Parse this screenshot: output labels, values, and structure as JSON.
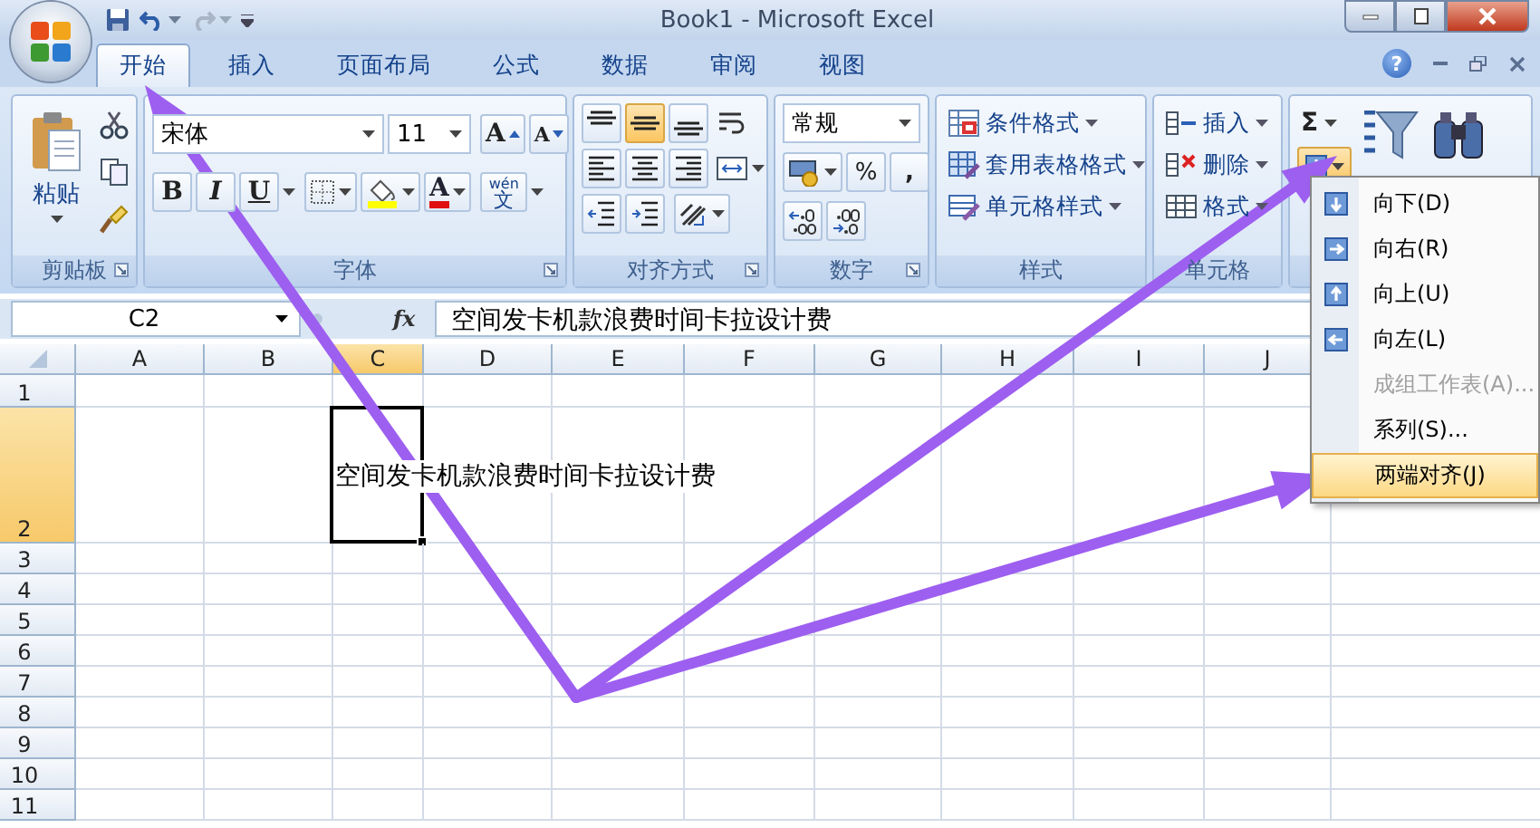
{
  "title_bar": {
    "title": "Book1 - Microsoft Excel"
  },
  "tabs": [
    {
      "label": "开始",
      "selected": true
    },
    {
      "label": "插入",
      "selected": false
    },
    {
      "label": "页面布局",
      "selected": false
    },
    {
      "label": "公式",
      "selected": false
    },
    {
      "label": "数据",
      "selected": false
    },
    {
      "label": "审阅",
      "selected": false
    },
    {
      "label": "视图",
      "selected": false
    }
  ],
  "help": "?",
  "ribbon": {
    "clipboard": {
      "label": "剪贴板",
      "paste": "粘贴"
    },
    "font": {
      "label": "字体",
      "font_name": "宋体",
      "font_size": "11",
      "grow": "A",
      "shrink": "A",
      "bold": "B",
      "italic": "I",
      "underline": "U",
      "font_color": "A",
      "phonetic_hint": "wén",
      "phonetic": "文"
    },
    "alignment": {
      "label": "对齐方式",
      "vertical": [
        {
          "kind": "top",
          "selected": false
        },
        {
          "kind": "middle",
          "selected": true
        },
        {
          "kind": "bottom",
          "selected": false
        }
      ],
      "horizontal": [
        {
          "kind": "left",
          "selected": false
        },
        {
          "kind": "center",
          "selected": false
        },
        {
          "kind": "right",
          "selected": false
        }
      ]
    },
    "number": {
      "label": "数字",
      "format": "常规",
      "percent": "%",
      "comma": ","
    },
    "styles": {
      "label": "样式",
      "items": [
        {
          "kind": "conditional",
          "label": "条件格式"
        },
        {
          "kind": "table",
          "label": "套用表格格式"
        },
        {
          "kind": "cell",
          "label": "单元格样式"
        }
      ]
    },
    "cells": {
      "label": "单元格",
      "items": [
        {
          "kind": "insert",
          "label": "插入"
        },
        {
          "kind": "delete",
          "label": "删除"
        },
        {
          "kind": "format",
          "label": "格式"
        }
      ]
    },
    "editing": {
      "sum": "Σ",
      "fill_expanded": true
    }
  },
  "formula_bar": {
    "name_box": "C2",
    "fx": "fx",
    "content": "空间发卡机款浪费时间卡拉设计费"
  },
  "sheet": {
    "columns": [
      {
        "label": "A",
        "selected": false
      },
      {
        "label": "B",
        "selected": false
      },
      {
        "label": "C",
        "selected": true
      },
      {
        "label": "D",
        "selected": false
      },
      {
        "label": "E",
        "selected": false
      },
      {
        "label": "F",
        "selected": false
      },
      {
        "label": "G",
        "selected": false
      },
      {
        "label": "H",
        "selected": false
      },
      {
        "label": "I",
        "selected": false
      },
      {
        "label": "J",
        "selected": false
      }
    ],
    "rows": [
      {
        "label": "1",
        "selected": false
      },
      {
        "label": "2",
        "selected": true,
        "text": "空间发卡机款浪费时间卡拉设计费"
      },
      {
        "label": "3",
        "selected": false
      },
      {
        "label": "4",
        "selected": false
      },
      {
        "label": "5",
        "selected": false
      },
      {
        "label": "6",
        "selected": false
      },
      {
        "label": "7",
        "selected": false
      },
      {
        "label": "8",
        "selected": false
      },
      {
        "label": "9",
        "selected": false
      },
      {
        "label": "10",
        "selected": false
      },
      {
        "label": "11",
        "selected": false
      }
    ]
  },
  "fill_menu": {
    "items": [
      {
        "kind": "down",
        "label": "向下(D)",
        "disabled": false,
        "selected": false
      },
      {
        "kind": "right",
        "label": "向右(R)",
        "disabled": false,
        "selected": false
      },
      {
        "kind": "up",
        "label": "向上(U)",
        "disabled": false,
        "selected": false
      },
      {
        "kind": "left",
        "label": "向左(L)",
        "disabled": false,
        "selected": false
      },
      {
        "kind": "plain",
        "label": "成组工作表(A)...",
        "disabled": true,
        "selected": false
      },
      {
        "kind": "plain",
        "label": "系列(S)...",
        "disabled": false,
        "selected": false
      },
      {
        "kind": "plain",
        "label": "两端对齐(J)",
        "disabled": false,
        "selected": true
      }
    ]
  }
}
